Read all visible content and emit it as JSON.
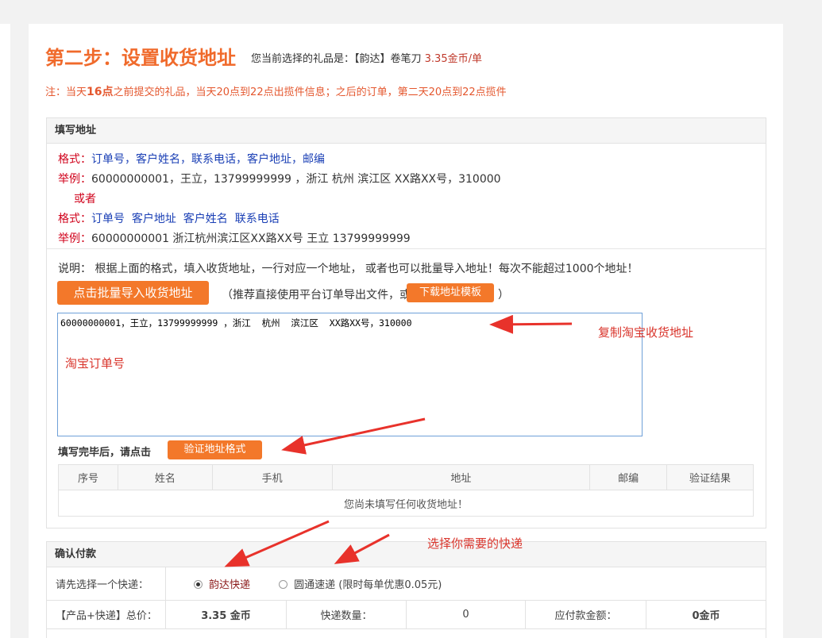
{
  "header": {
    "title": "第二步：设置收货地址",
    "selected_prefix": "您当前选择的礼品是：【韵达】卷笔刀",
    "selected_price": "3.35金币/单"
  },
  "note": {
    "prefix": "注：当天",
    "highlight": "16点",
    "suffix": "之前提交的礼品，当天20点到22点出揽件信息；之后的订单，第二天20点到22点揽件"
  },
  "address_panel": {
    "title": "填写地址",
    "format1_label": "格式：",
    "format1_fields": "订单号，客户姓名，联系电话，客户地址，邮编",
    "example1_label": "举例：",
    "example1": "60000000001，王立，13799999999 ，浙江 杭州 滨江区 XX路XX号，310000",
    "or_text": "或者",
    "format2_label": "格式：",
    "format2_fields": "订单号  客户地址  客户姓名  联系电话",
    "example2_label": "举例：",
    "example2": "60000000001 浙江杭州滨江区XX路XX号 王立 13799999999",
    "instructions": "说明： 根据上面的格式，填入收货地址，一行对应一个地址， 或者也可以批量导入地址！每次不能超过1000个地址！",
    "import_button": "点击批量导入收货地址",
    "recommend_text": "（推荐直接使用平台订单导出文件，或",
    "recommend_close": "）",
    "template_button": "下载地址模板",
    "textarea_value": "60000000001，王立，13799999999 ，浙江  杭州  滨江区  XX路XX号，310000",
    "verify_prompt": "填写完毕后，请点击",
    "verify_button": "验证地址格式",
    "table_headers": [
      "序号",
      "姓名",
      "手机",
      "地址",
      "邮编",
      "验证结果"
    ],
    "empty_message": "您尚未填写任何收货地址！"
  },
  "annotations": {
    "copy_address": "复制淘宝收货地址",
    "taobao_order": "淘宝订单号",
    "choose_express": "选择你需要的快递"
  },
  "payment_panel": {
    "title": "确认付款",
    "choose_label": "请先选择一个快递：",
    "option_yunda": "韵达快递",
    "option_yuantong": "圆通速递 (限时每单优惠0.05元)",
    "total_label": "【产品+快递】总价：",
    "total_value": "3.35 金币",
    "count_label": "快递数量：",
    "count_value": "0",
    "due_label": "应付款金额：",
    "due_value": "0金币"
  },
  "colors": {
    "accent": "#f3782a",
    "title": "#f06a2b",
    "annotation": "#d9342b"
  }
}
